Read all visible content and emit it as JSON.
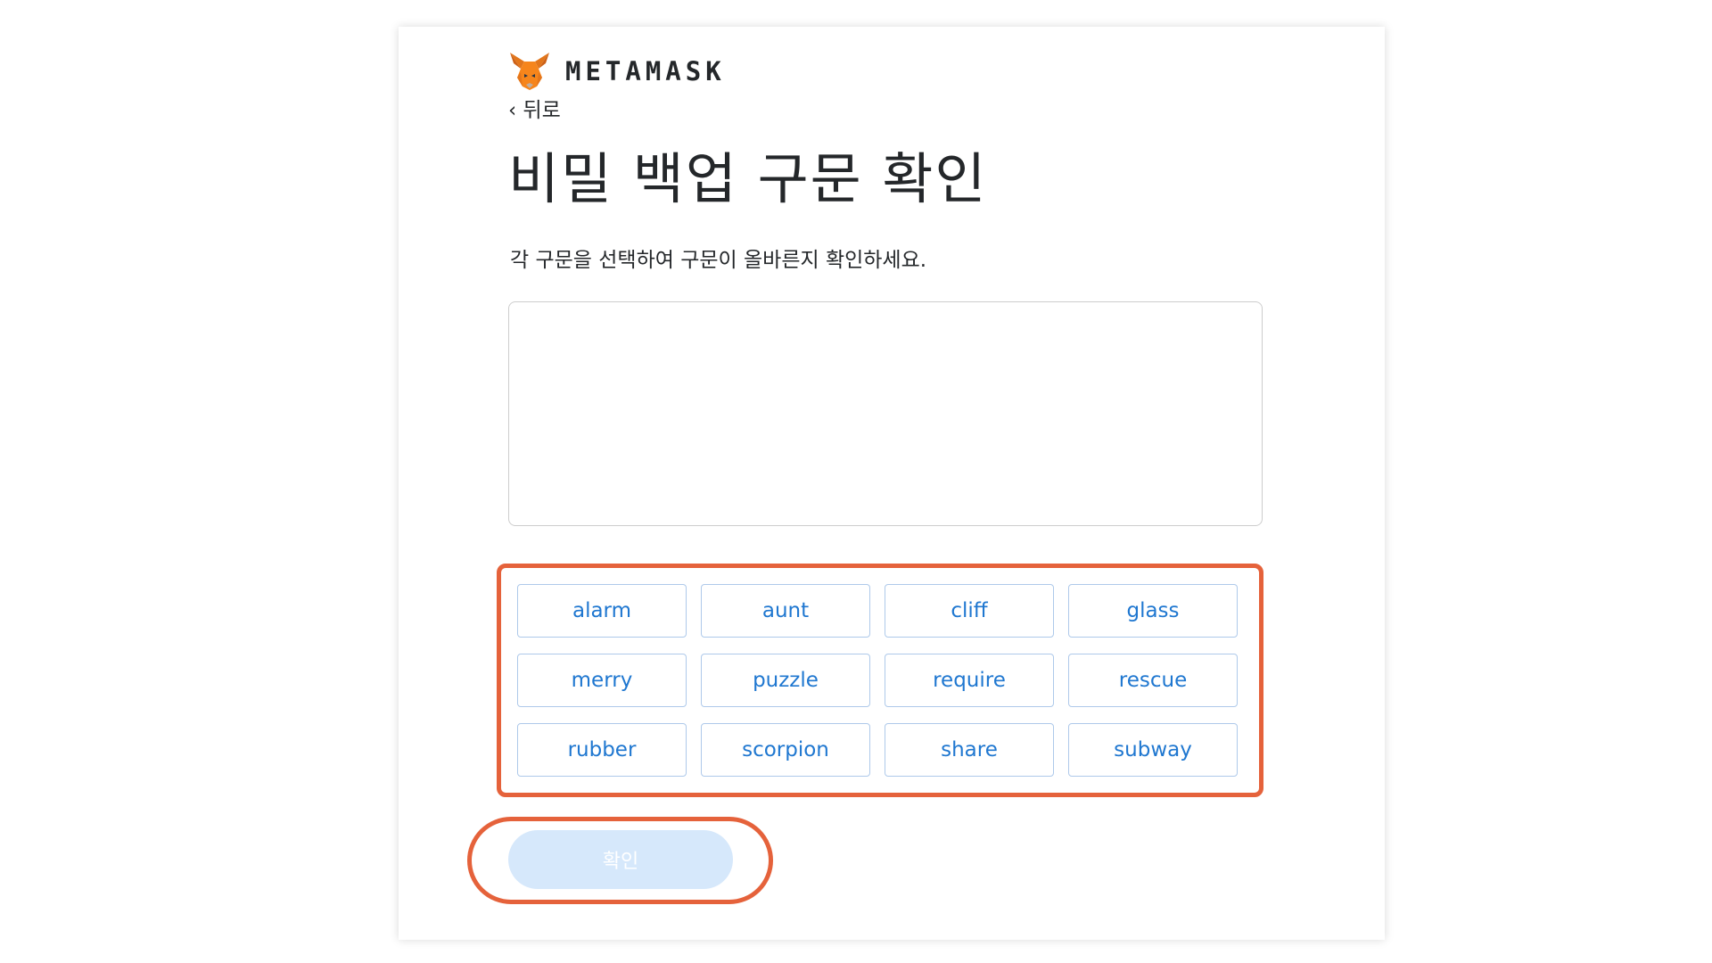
{
  "header": {
    "brand": "METAMASK",
    "back_label": "‹ 뒤로"
  },
  "main": {
    "title": "비밀 백업 구문 확인",
    "subtitle": "각 구문을 선택하여 구문이 올바른지 확인하세요.",
    "selected_phrase": "",
    "words": [
      "alarm",
      "aunt",
      "cliff",
      "glass",
      "merry",
      "puzzle",
      "require",
      "rescue",
      "rubber",
      "scorpion",
      "share",
      "subway"
    ],
    "confirm_label": "확인"
  },
  "colors": {
    "accent": "#1f77d0",
    "highlight": "#e5623b",
    "button_disabled": "#d6e8fb"
  },
  "icons": {
    "logo": "metamask-fox-icon"
  }
}
